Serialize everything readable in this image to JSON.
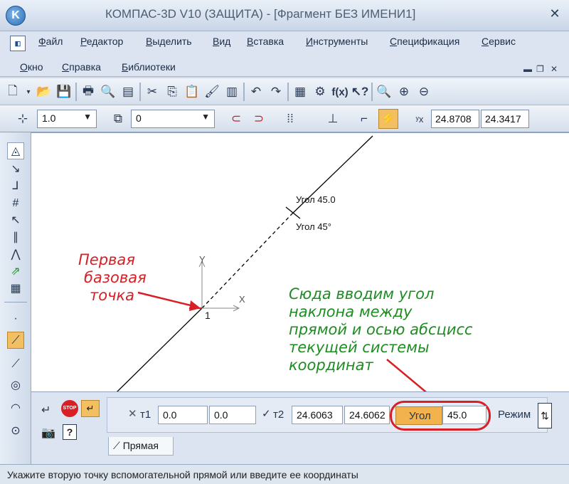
{
  "title": "КОМПАС-3D V10 (ЗАЩИТА) - [Фрагмент БЕЗ ИМЕНИ1]",
  "menu": {
    "row1": [
      "Файл",
      "Редактор",
      "Выделить",
      "Вид",
      "Вставка",
      "Инструменты",
      "Спецификация",
      "Сервис"
    ],
    "row2": [
      "Окно",
      "Справка",
      "Библиотеки"
    ]
  },
  "toolbar2": {
    "step_value": "1.0",
    "layer_value": "0",
    "coord_x": "24.8708",
    "coord_y": "24.3417"
  },
  "canvas": {
    "angle_label_1": "Угол 45.0",
    "angle_label_2": "Угол 45°",
    "axis_y": "Y",
    "axis_x": "X",
    "point_number": "1"
  },
  "annotations": {
    "first_point": [
      "Первая",
      "базовая",
      "точка"
    ],
    "angle_hint": [
      "Сюда вводим угол",
      "наклона между",
      "прямой и осью абсцисс",
      "текущей системы",
      "координат"
    ]
  },
  "props": {
    "t1_label": "т1",
    "t1_x": "0.0",
    "t1_y": "0.0",
    "t2_label": "т2",
    "t2_x": "24.6063",
    "t2_y": "24.6062",
    "angle_label": "Угол",
    "angle_value": "45.0",
    "mode_label": "Режим",
    "tab_label": "Прямая",
    "stop_label": "STOP"
  },
  "status": "Укажите вторую точку вспомогательной прямой или введите ее координаты",
  "colors": {
    "annotation_red": "#d81f25",
    "annotation_green": "#1d8d22",
    "highlight": "#f2b24e"
  }
}
